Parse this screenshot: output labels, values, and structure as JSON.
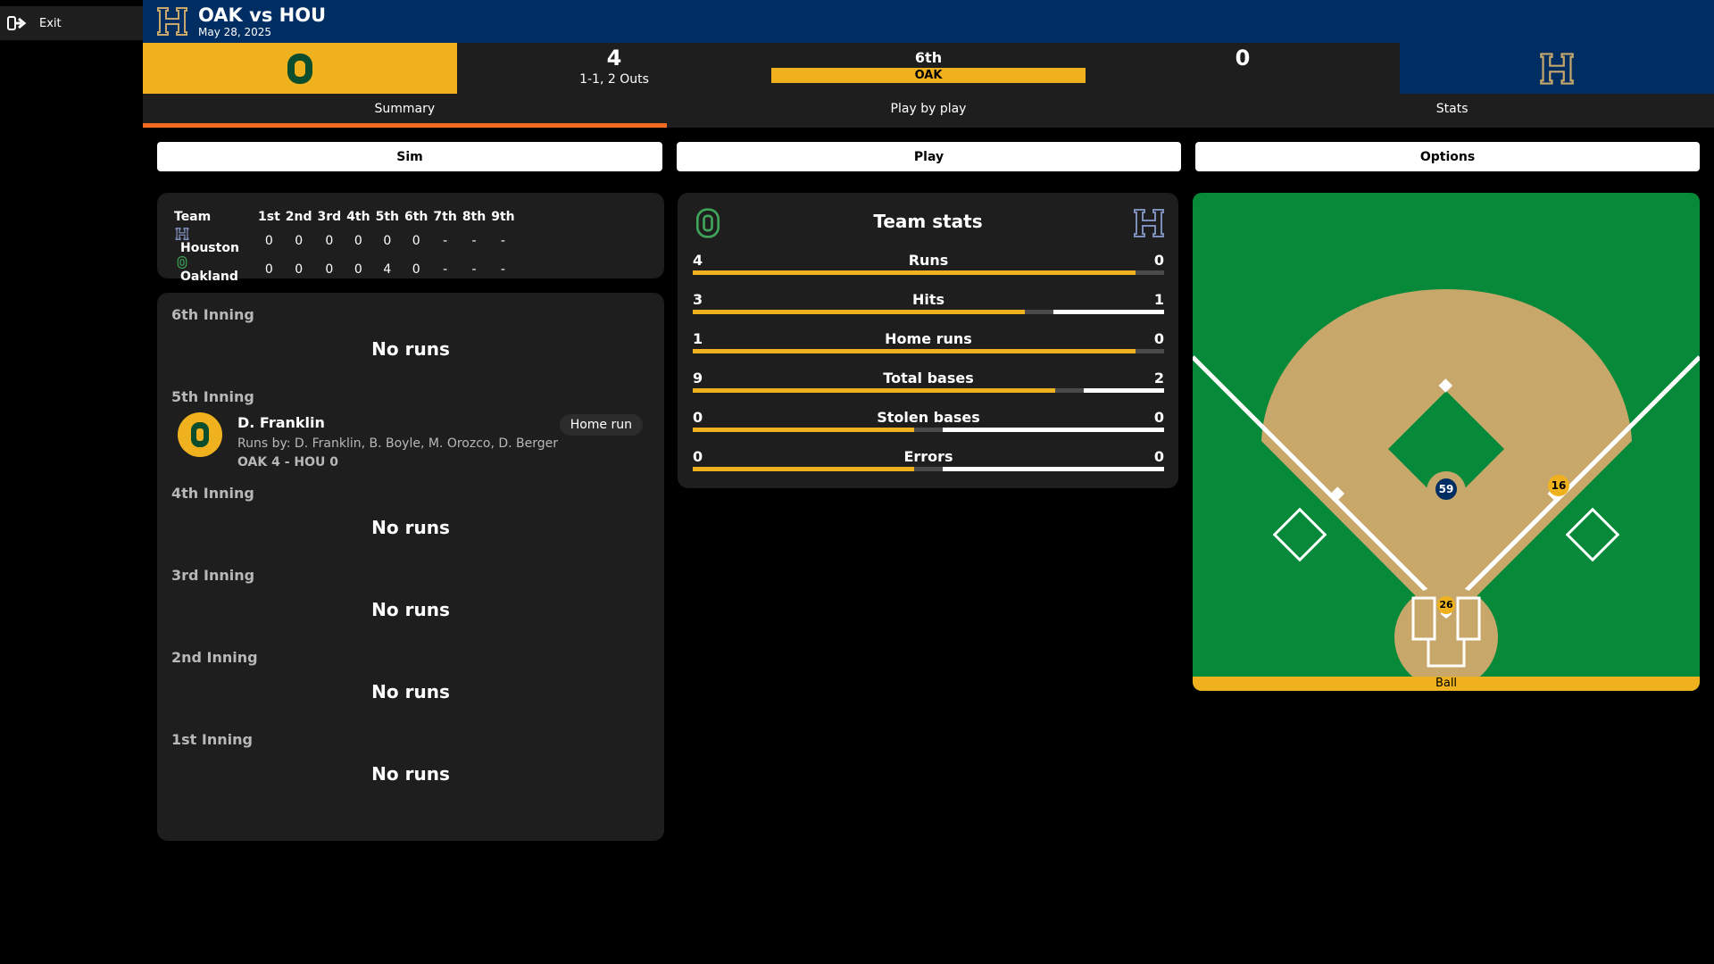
{
  "nav": {
    "exit_label": "Exit"
  },
  "header": {
    "title": "OAK vs HOU",
    "date": "May 28, 2025"
  },
  "scoreboard": {
    "away_score": "4",
    "count_outs": "1-1, 2 Outs",
    "inning": "6th",
    "batting_team": "OAK",
    "home_score": "0"
  },
  "tabs": [
    "Summary",
    "Play by play",
    "Stats"
  ],
  "actions": {
    "sim": "Sim",
    "play": "Play",
    "options": "Options"
  },
  "linescore": {
    "headers": [
      "Team",
      "1st",
      "2nd",
      "3rd",
      "4th",
      "5th",
      "6th",
      "7th",
      "8th",
      "9th"
    ],
    "rows": [
      {
        "team": "Houston",
        "innings": [
          "0",
          "0",
          "0",
          "0",
          "0",
          "0",
          "-",
          "-",
          "-"
        ]
      },
      {
        "team": "Oakland",
        "innings": [
          "0",
          "0",
          "0",
          "0",
          "4",
          "0",
          "-",
          "-",
          "-"
        ]
      }
    ]
  },
  "summary": {
    "innings": [
      {
        "label": "6th Inning",
        "text": "No runs"
      },
      {
        "label": "5th Inning",
        "play": {
          "batter": "D. Franklin",
          "type": "Home run",
          "runs_by": "Runs by: D. Franklin, B. Boyle, M. Orozco, D. Berger",
          "score": "OAK 4 - HOU 0"
        }
      },
      {
        "label": "4th Inning",
        "text": "No runs"
      },
      {
        "label": "3rd Inning",
        "text": "No runs"
      },
      {
        "label": "2nd Inning",
        "text": "No runs"
      },
      {
        "label": "1st Inning",
        "text": "No runs"
      }
    ]
  },
  "team_stats": {
    "title": "Team stats",
    "rows": [
      {
        "label": "Runs",
        "away": "4",
        "home": "0"
      },
      {
        "label": "Hits",
        "away": "3",
        "home": "1"
      },
      {
        "label": "Home runs",
        "away": "1",
        "home": "0"
      },
      {
        "label": "Total bases",
        "away": "9",
        "home": "2"
      },
      {
        "label": "Stolen bases",
        "away": "0",
        "home": "0"
      },
      {
        "label": "Errors",
        "away": "0",
        "home": "0"
      }
    ]
  },
  "field": {
    "status": "Ball",
    "players": [
      {
        "number": "59",
        "team": "home"
      },
      {
        "number": "16",
        "team": "away"
      },
      {
        "number": "26",
        "team": "away"
      }
    ]
  },
  "colors": {
    "away": "#efb21e",
    "away_dark": "#0b4d2c",
    "home": "#002d62",
    "accent": "#f26b21",
    "grass": "#07893a",
    "dirt": "#c8a86a"
  }
}
